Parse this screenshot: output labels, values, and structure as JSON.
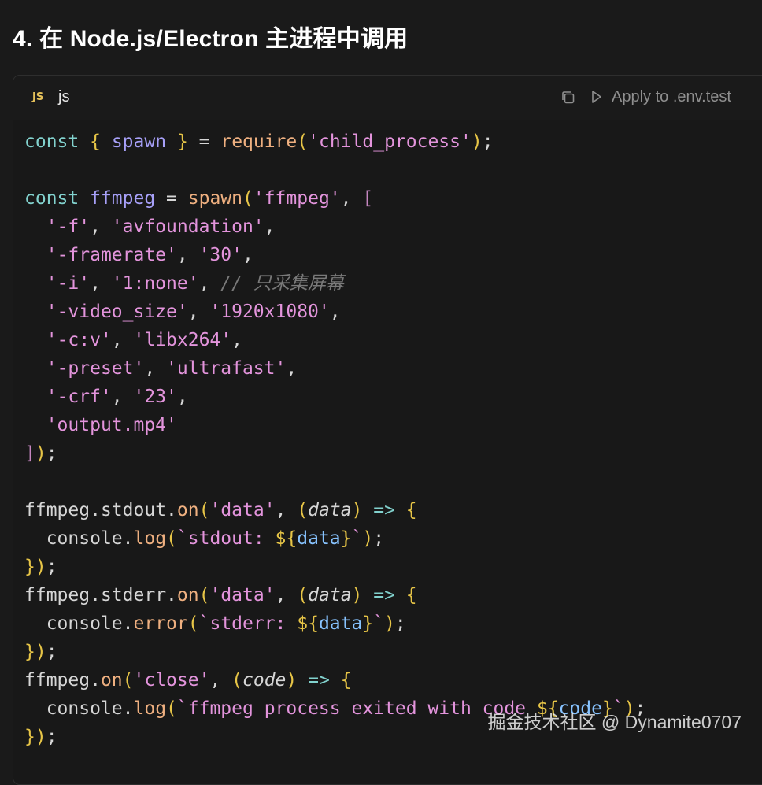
{
  "heading": "4. 在 Node.js/Electron 主进程中调用",
  "code_block": {
    "lang_badge": "JS",
    "lang_label": "js",
    "copy_icon": "copy-icon",
    "apply_label": "Apply to .env.test",
    "lines": [
      "const { spawn } = require('child_process');",
      "",
      "const ffmpeg = spawn('ffmpeg', [",
      "  '-f', 'avfoundation',",
      "  '-framerate', '30',",
      "  '-i', '1:none', // 只采集屏幕",
      "  '-video_size', '1920x1080',",
      "  '-c:v', 'libx264',",
      "  '-preset', 'ultrafast',",
      "  '-crf', '23',",
      "  'output.mp4'",
      "]);",
      "",
      "ffmpeg.stdout.on('data', (data) => {",
      "  console.log(`stdout: ${data}`);",
      "});",
      "ffmpeg.stderr.on('data', (data) => {",
      "  console.error(`stderr: ${data}`);",
      "});",
      "ffmpeg.on('close', (code) => {",
      "  console.log(`ffmpeg process exited with code ${code}`);",
      "});"
    ]
  },
  "watermark": "掘金技术社区 @ Dynamite0707",
  "colors": {
    "background": "#1a1a1a",
    "keyword": "#82d2ce",
    "string": "#e394dc",
    "variable": "#a7a0f8",
    "function": "#efb080",
    "bracket": "#e7c547",
    "comment": "#7a7a7a"
  }
}
